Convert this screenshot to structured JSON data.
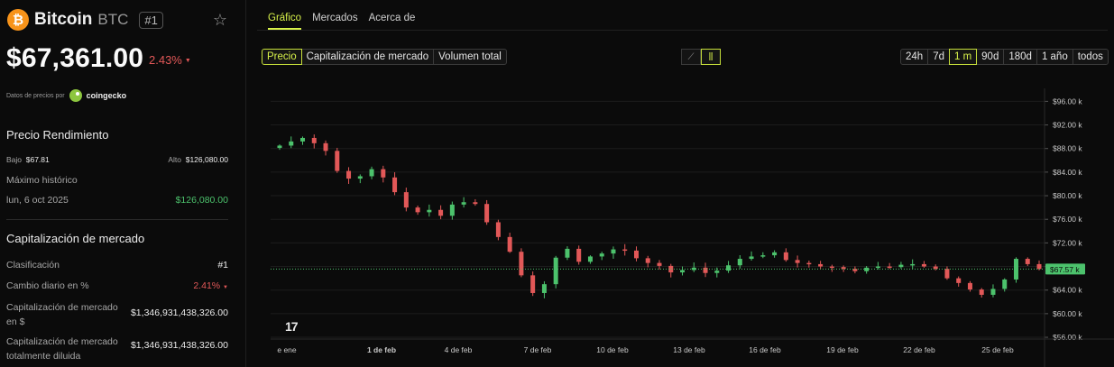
{
  "coin": {
    "logo_glyph": "₿",
    "name": "Bitcoin",
    "symbol": "BTC",
    "rank_badge": "#1",
    "price": "$67,361.00",
    "change": "2.43%",
    "change_color": "#e25858"
  },
  "source": {
    "label": "Datos de precios por",
    "provider": "coingecko"
  },
  "performance": {
    "title": "Precio Rendimiento",
    "low_label": "Bajo",
    "low_value": "$67.81",
    "high_label": "Alto",
    "high_value": "$126,080.00",
    "ath_label": "Máximo histórico",
    "ath_date": "lun, 6 oct 2025",
    "ath_value": "$126,080.00"
  },
  "market": {
    "title": "Capitalización de mercado",
    "rank_label": "Clasificación",
    "rank_value": "#1",
    "daily_change_label": "Cambio diario en %",
    "daily_change_value": "2.41%",
    "cap_label_1": "Capitalización de mercado",
    "cap_label_2": "en $",
    "cap_value": "$1,346,931,438,326.00",
    "fdv_label_1": "Capitalización de mercado",
    "fdv_label_2": "totalmente diluida",
    "fdv_value": "$1,346,931,438,326.00"
  },
  "tabs": [
    "Gráfico",
    "Mercados",
    "Acerca de"
  ],
  "metric_buttons": [
    "Precio",
    "Capitalización de mercado",
    "Volumen total"
  ],
  "range_buttons": [
    "24h",
    "7d",
    "1 m",
    "90d",
    "180d",
    "1 año",
    "todos"
  ],
  "active_range": "1 m",
  "tv_logo": "17",
  "colors": {
    "accent": "#d8f24a",
    "up": "#4cc26c",
    "down": "#e25858",
    "price_line": "#4cc26c"
  },
  "chart_data": {
    "type": "candlestick",
    "x_tick_labels": [
      "e ene",
      "1 de feb",
      "4 de feb",
      "7 de feb",
      "10 de feb",
      "13 de feb",
      "16 de feb",
      "19 de feb",
      "22 de feb",
      "25 de feb"
    ],
    "y_tick_labels": [
      "$96.00 k",
      "$92.00 k",
      "$88.00 k",
      "$84.00 k",
      "$80.00 k",
      "$76.00 k",
      "$72.00 k",
      "$68.00 k",
      "$64.00 k",
      "$60.00 k",
      "$56.00 k"
    ],
    "y_ticks": [
      96,
      92,
      88,
      84,
      80,
      76,
      72,
      68,
      64,
      60,
      56
    ],
    "ylim": [
      55.7,
      98.2
    ],
    "y_unit": "k USD",
    "current_price_label": "$67.57 k",
    "current_price": 67.57,
    "closes_k": [
      88.5,
      89.2,
      89.8,
      88.9,
      87.6,
      84.2,
      82.9,
      83.3,
      84.5,
      83.1,
      80.6,
      78.0,
      77.2,
      77.6,
      76.6,
      78.5,
      78.9,
      78.6,
      75.5,
      73.0,
      70.5,
      66.5,
      63.5,
      65.0,
      69.5,
      71.0,
      68.8,
      69.7,
      70.2,
      70.9,
      70.7,
      69.4,
      68.6,
      68.1,
      67.0,
      67.4,
      67.8,
      66.9,
      67.3,
      68.2,
      69.3,
      69.7,
      69.9,
      70.4,
      69.1,
      68.6,
      68.4,
      68.0,
      67.9,
      67.6,
      67.2,
      67.8,
      68.0,
      67.9,
      68.3,
      68.4,
      68.0,
      67.6,
      66.0,
      65.2,
      64.1,
      63.2,
      64.2,
      65.8,
      69.3,
      68.4,
      67.57
    ],
    "grid": true,
    "price_line_dotted": true
  }
}
